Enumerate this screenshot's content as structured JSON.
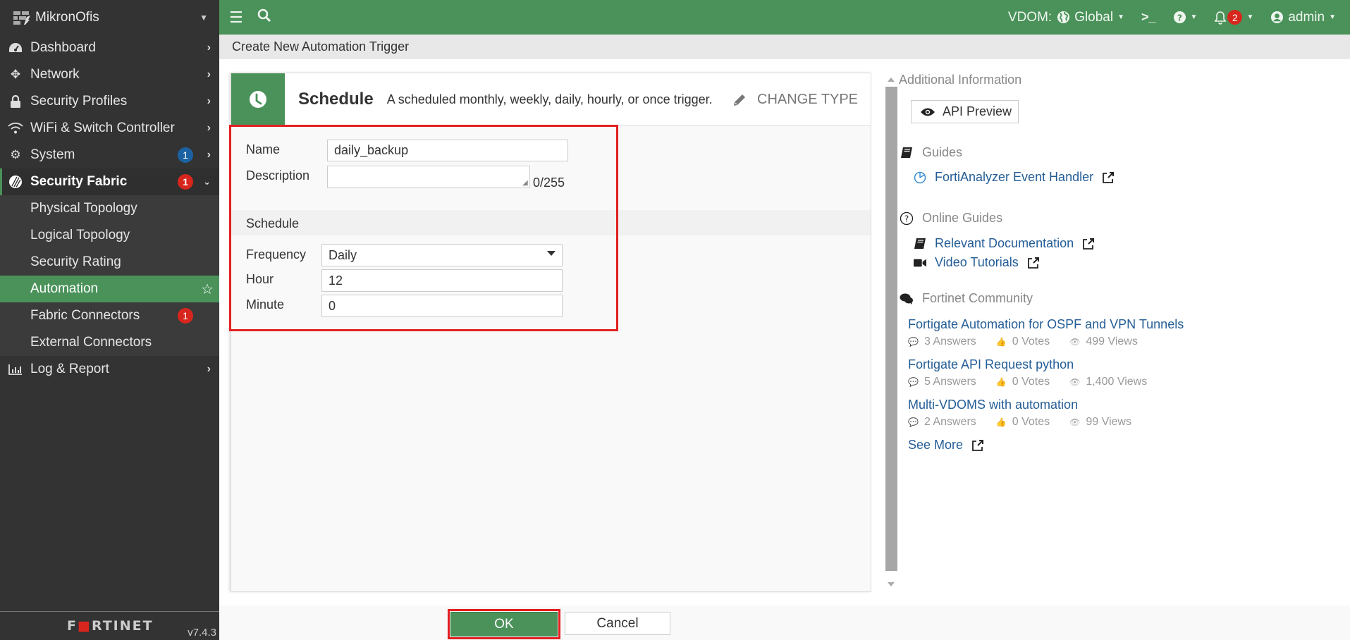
{
  "sidebar": {
    "device_name": "MikronOfis",
    "items": [
      {
        "label": "Dashboard",
        "icon": "dashboard-icon"
      },
      {
        "label": "Network",
        "icon": "network-icon"
      },
      {
        "label": "Security Profiles",
        "icon": "lock-icon"
      },
      {
        "label": "WiFi & Switch Controller",
        "icon": "wifi-icon"
      },
      {
        "label": "System",
        "icon": "gear-icon",
        "badge": "1"
      },
      {
        "label": "Security Fabric",
        "icon": "security-fabric-icon",
        "badge": "1",
        "expanded": true
      },
      {
        "label": "Physical Topology"
      },
      {
        "label": "Logical Topology"
      },
      {
        "label": "Security Rating"
      },
      {
        "label": "Automation",
        "active": true
      },
      {
        "label": "Fabric Connectors",
        "badge": "1"
      },
      {
        "label": "External Connectors"
      },
      {
        "label": "Log & Report",
        "icon": "chart-icon"
      }
    ],
    "footer": {
      "brand": "FORTINET",
      "version": "v7.4.3"
    }
  },
  "topbar": {
    "vdom_label": "VDOM:",
    "vdom_value": "Global",
    "notification_count": "2",
    "user": "admin"
  },
  "breadcrumb": "Create New Automation Trigger",
  "trigger": {
    "type_title": "Schedule",
    "type_description": "A scheduled monthly, weekly, daily, hourly, or once trigger.",
    "change_type_label": "CHANGE TYPE"
  },
  "form": {
    "name_label": "Name",
    "name_value": "daily_backup",
    "description_label": "Description",
    "description_value": "",
    "description_counter": "0/255",
    "schedule_section": "Schedule",
    "frequency_label": "Frequency",
    "frequency_value": "Daily",
    "hour_label": "Hour",
    "hour_value": "12",
    "minute_label": "Minute",
    "minute_value": "0"
  },
  "right_panel": {
    "title": "Additional Information",
    "api_preview_label": "API Preview",
    "guides_title": "Guides",
    "guides": [
      {
        "label": "FortiAnalyzer Event Handler"
      }
    ],
    "online_guides_title": "Online Guides",
    "online_guides": [
      {
        "label": "Relevant Documentation"
      },
      {
        "label": "Video Tutorials"
      }
    ],
    "community_title": "Fortinet Community",
    "community_posts": [
      {
        "title": "Fortigate Automation for OSPF and VPN Tunnels",
        "answers": "3 Answers",
        "votes": "0 Votes",
        "views": "499 Views"
      },
      {
        "title": "Fortigate API Request python",
        "answers": "5 Answers",
        "votes": "0 Votes",
        "views": "1,400 Views"
      },
      {
        "title": "Multi-VDOMS with automation",
        "answers": "2 Answers",
        "votes": "0 Votes",
        "views": "99 Views"
      }
    ],
    "see_more_label": "See More"
  },
  "footer": {
    "ok_label": "OK",
    "cancel_label": "Cancel"
  },
  "colors": {
    "brand_green": "#4a925a",
    "sidebar_bg": "#333333",
    "badge_red": "#d7261e",
    "badge_blue": "#1c62a2",
    "link_blue": "#245d96",
    "highlight_red": "#e32020"
  }
}
